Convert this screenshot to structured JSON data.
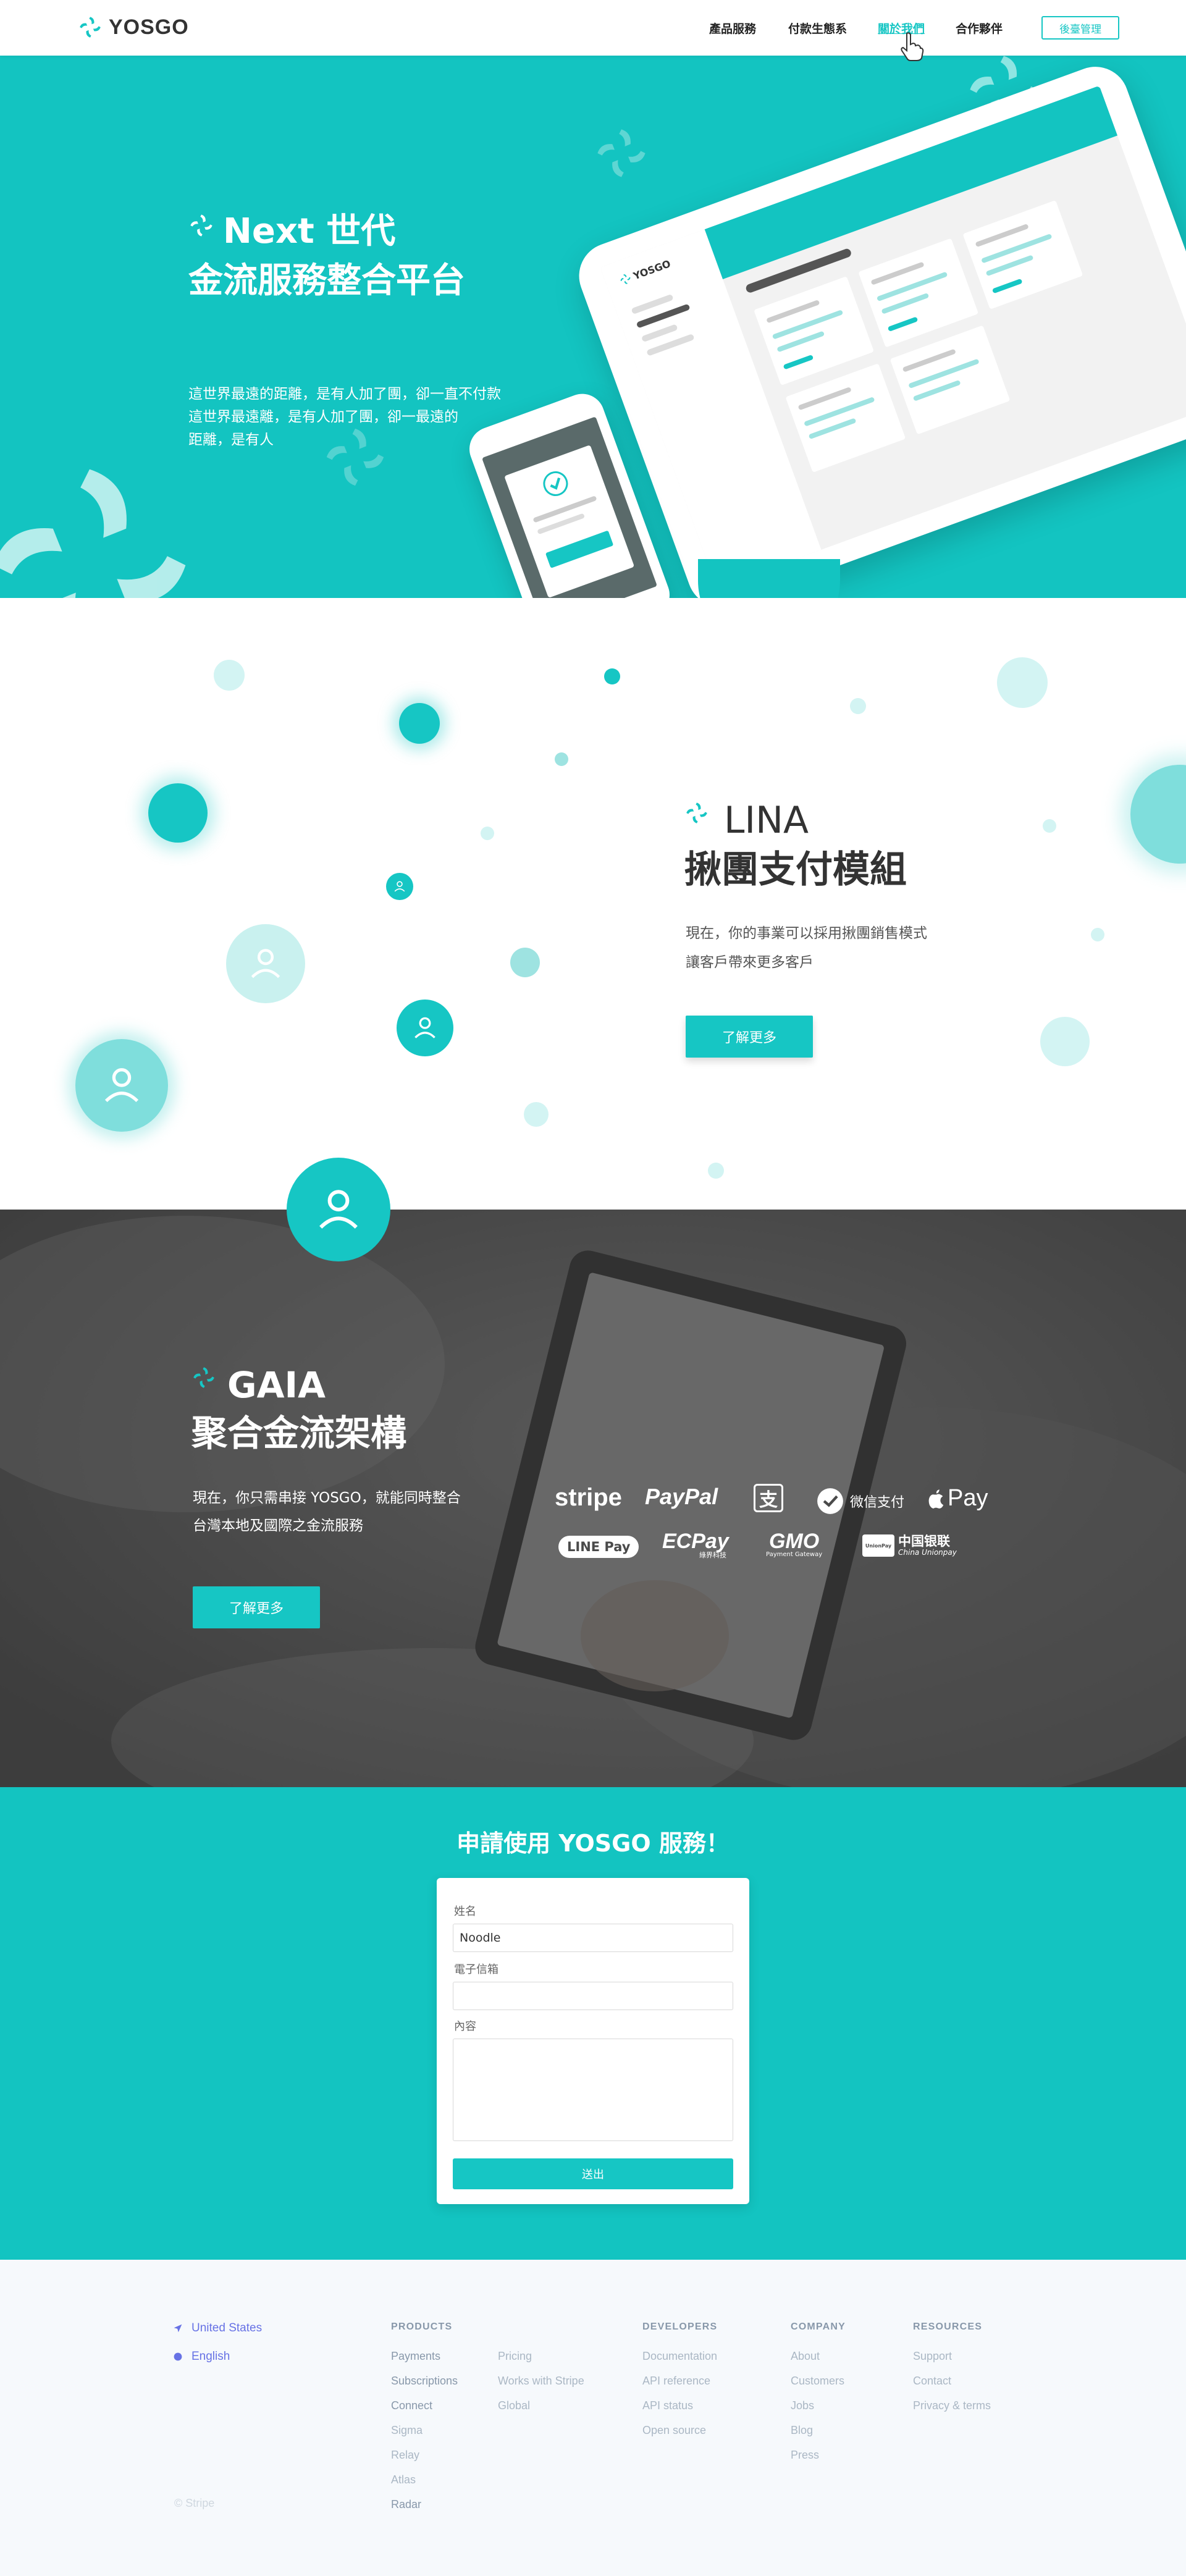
{
  "header": {
    "brand": "YOSGO",
    "nav": [
      "產品服務",
      "付款生態系",
      "關於我們",
      "合作夥伴"
    ],
    "active_nav": "關於我們",
    "backend_button": "後臺管理"
  },
  "hero": {
    "title_line1": "Next 世代",
    "title_line2": "金流服務整合平台",
    "desc_line1": "這世界最遠的距離，是有人加了團，卻一直不付款",
    "desc_line2": "這世界最遠離，是有人加了團，卻一最遠的",
    "desc_line3": "距離，是有人",
    "tablet_brand": "YOSGO"
  },
  "lina": {
    "title_line1": "LINA",
    "title_line2": "揪團支付模組",
    "desc_line1": "現在，你的事業可以採用揪團銷售模式",
    "desc_line2": "讓客戶帶來更多客戶",
    "button": "了解更多"
  },
  "gaia": {
    "title_line1": "GAIA",
    "title_line2": "聚合金流架構",
    "desc_line1": "現在，你只需串接 YOSGO，就能同時整合",
    "desc_line2": "台灣本地及國際之金流服務",
    "button": "了解更多",
    "payment_logos": {
      "stripe": "stripe",
      "paypal": "PayPal",
      "alipay": "支",
      "wechat": "微信支付",
      "applepay": "Pay",
      "linepay": "LINE Pay",
      "ecpay": "ECPay",
      "ecpay_sub": "綠界科技",
      "gmo": "GMO",
      "gmo_sub": "Payment Gateway",
      "unionpay": "中国银联",
      "unionpay_sub": "China Unionpay",
      "unionpay_badge": "UnionPay"
    }
  },
  "apply": {
    "title": "申請使用 YOSGO 服務！",
    "name_label": "姓名",
    "name_value": "Noodle",
    "email_label": "電子信箱",
    "email_value": "",
    "content_label": "內容",
    "submit": "送出"
  },
  "footer": {
    "country": "United States",
    "language": "English",
    "copyright": "© Stripe",
    "products_heading": "PRODUCTS",
    "products_col1": [
      "Payments",
      "Subscriptions",
      "Connect",
      "Sigma",
      "Relay",
      "Atlas",
      "Radar"
    ],
    "products_col2": [
      "Pricing",
      "Works with Stripe",
      "Global"
    ],
    "developers_heading": "DEVELOPERS",
    "developers": [
      "Documentation",
      "API reference",
      "API status",
      "Open source"
    ],
    "company_heading": "COMPANY",
    "company": [
      "About",
      "Customers",
      "Jobs",
      "Blog",
      "Press"
    ],
    "resources_heading": "RESOURCES",
    "resources": [
      "Support",
      "Contact",
      "Privacy & terms"
    ]
  },
  "colors": {
    "teal": "#13c4c1",
    "footer_bg": "#f6f9fc",
    "footer_accent": "#6772e5"
  }
}
